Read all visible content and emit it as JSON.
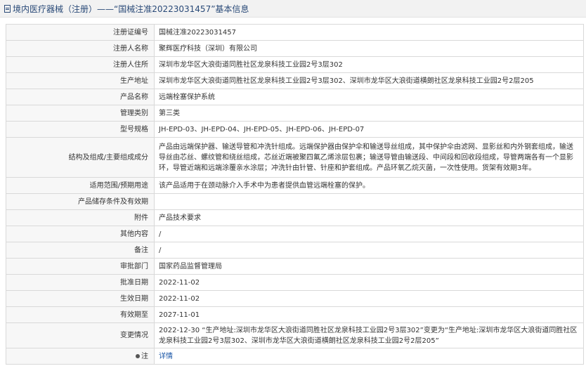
{
  "header": {
    "title": "境内医疗器械（注册）——“国械注准20223031457”基本信息"
  },
  "rows": [
    {
      "label": "注册证编号",
      "value": "国械注准20223031457"
    },
    {
      "label": "注册人名称",
      "value": "聚辉医疗科技（深圳）有限公司"
    },
    {
      "label": "注册人住所",
      "value": "深圳市龙华区大浪街道同胜社区龙泉科技工业园2号3层302"
    },
    {
      "label": "生产地址",
      "value": "深圳市龙华区大浪街道同胜社区龙泉科技工业园2号3层302、深圳市龙华区大浪街道横朗社区龙泉科技工业园2号2层205"
    },
    {
      "label": "产品名称",
      "value": "远端栓塞保护系统"
    },
    {
      "label": "管理类别",
      "value": "第三类"
    },
    {
      "label": "型号规格",
      "value": "JH-EPD-03、JH-EPD-04、JH-EPD-05、JH-EPD-06、JH-EPD-07"
    },
    {
      "label": "结构及组成/主要组成成分",
      "value": "产品由远端保护器、输送导管和冲洗针组成。远端保护器由保护伞和输送导丝组成，其中保护伞由滤网、显影丝和内外钢套组成，输送导丝由芯丝、螺纹管和绕丝组成，芯丝近端被聚四氟乙烯涂层包裹；输送导管由输送段、中间段和回收段组成，导管两端各有一个显影环，导管近端和远端涂覆亲水涂层；冲洗针由针管、针座和护套组成。产品环氧乙烷灭菌，一次性使用。货架有效期3年。"
    },
    {
      "label": "适用范围/预期用途",
      "value": "该产品适用于在颈动脉介入手术中为患者提供血管远端栓塞的保护。"
    },
    {
      "label": "产品储存条件及有效期",
      "value": ""
    },
    {
      "label": "附件",
      "value": "产品技术要求"
    },
    {
      "label": "其他内容",
      "value": "/"
    },
    {
      "label": "备注",
      "value": "/"
    },
    {
      "label": "审批部门",
      "value": "国家药品监督管理局"
    },
    {
      "label": "批准日期",
      "value": "2022-11-02"
    },
    {
      "label": "生效日期",
      "value": "2022-11-02"
    },
    {
      "label": "有效期至",
      "value": "2027-11-01"
    },
    {
      "label": "变更情况",
      "value": "2022-12-30 “生产地址:深圳市龙华区大浪街道同胜社区龙泉科技工业园2号3层302”变更为“生产地址:深圳市龙华区大浪街道同胜社区龙泉科技工业园2号3层302、深圳市龙华区大浪街道横朗社区龙泉科技工业园2号2层205”"
    }
  ],
  "footer_row": {
    "label": "注",
    "link": "详情"
  }
}
